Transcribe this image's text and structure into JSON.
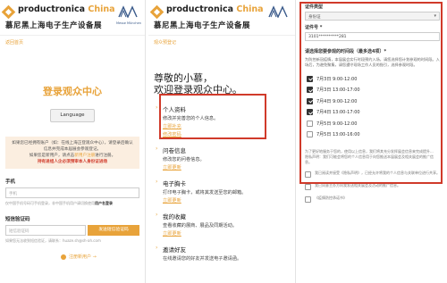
{
  "brand": {
    "name_en": "productronica",
    "name_cn_suffix": "China",
    "name_cn": "慕尼黑上海电子生产设备展",
    "partner_caption": "Messe München"
  },
  "panel1": {
    "back_link": "返回首页",
    "title": "登录观众中心",
    "language_button": "Language",
    "notice_line1": "如果您已经拥有账户（如：在线上海正登观众中心），请登录后确认信息并完成本届展会参观登记。",
    "notice_line2": "如果您是新用户，请点击",
    "notice_register": "新用户注册",
    "notice_line2_end": "进行注册。",
    "notice_red": "持有进组人企必须预审本人身份证进场",
    "phone_label": "手机",
    "phone_placeholder": "手机",
    "phone_hint_a": "仅中国手机号码可手机登录，非中国手机用户请切换使用",
    "phone_hint_b": "用户名登录",
    "code_label": "短信验证码",
    "code_placeholder": "短信验证码",
    "code_button": "发送短信验证码",
    "code_hint": "如果您无法收到短信验证，请联系：huaze.sh@sh-ah.com",
    "register_link": "注册新用户 →"
  },
  "panel2": {
    "back_link": "观众预登记",
    "greeting_line1": "尊敬的小慕，",
    "greeting_line2": "欢迎登录观众中心。",
    "menu": [
      {
        "head": "个人资料",
        "desc": "修改并完善您的个人信息。",
        "links": [
          "立即补充",
          "修改密码"
        ]
      },
      {
        "head": "问卷信息",
        "desc": "修改您的问卷信息。",
        "links": [
          "立即更新"
        ]
      },
      {
        "head": "电子胸卡",
        "desc": "打印电子胸卡，或将其发送至您的邮箱。",
        "links": [
          "立即更新"
        ]
      },
      {
        "head": "我的收藏",
        "desc": "查看收藏的展商、展品及同期活动。",
        "links": [
          "立即更新"
        ]
      },
      {
        "head": "邀请好友",
        "desc": "在线邀请您的好友并发送电子邀请函。",
        "links": []
      }
    ]
  },
  "panel3": {
    "id_type_label": "证件类型",
    "id_type_value": "身份证",
    "id_number_label": "证件号 *",
    "id_number_value": "3101**********281",
    "visit_question": "请选择您要参观的时间段（最多选4项）*",
    "visit_hint": "为防控新冠疫情，本届展会实行时段预约入场，请您选择您计划参观的时间段。入场后，为避免聚集，请您遵守现场工作人员的指引，选择参观时段。",
    "slots": [
      {
        "label": "7月3日 9:00-12:00",
        "checked": true
      },
      {
        "label": "7月3日 13:00-17:00",
        "checked": true
      },
      {
        "label": "7月4日 9:00-12:00",
        "checked": true
      },
      {
        "label": "7月4日 13:00-17:00",
        "checked": true
      },
      {
        "label": "7月5日 9:00-12:00",
        "checked": false
      },
      {
        "label": "7月5日 13:00-16:00",
        "checked": false
      }
    ],
    "legal_text": "为了更好地服务于您的，使用以上信息，我们将其充分发挥展会信息来完成提升...",
    "privacy_text": "隐私声明：我们可能会将您的个人信息用于向您推送本届展会及相关展会的推广信息。",
    "agree1": "我已阅读并接受《隐私声明》，已经允许将我的个人信息与关联单位进行共享。",
    "agree2": "我已同意主办方向我发送相关展会及活动的推广信息。",
    "agree_link": "《疫情防控承诺书》"
  },
  "colors": {
    "accent": "#e8a33a",
    "highlight_box": "#d03a2a"
  },
  "icons": [
    "diamond-logo-icon",
    "messe-muenchen-logo-icon",
    "arrow-right-icon",
    "checkbox-checked-icon",
    "checkbox-empty-icon",
    "dropdown-chevron-icon"
  ]
}
